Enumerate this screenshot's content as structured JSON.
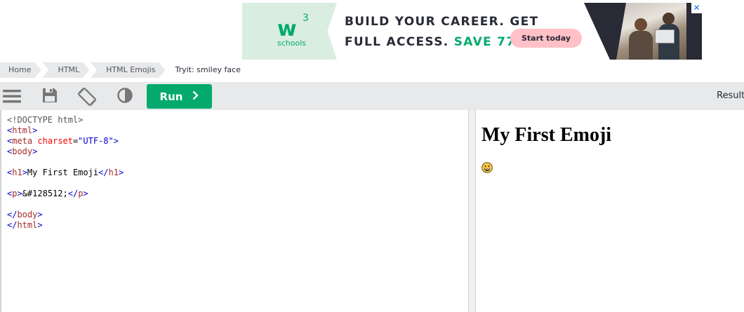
{
  "ad": {
    "logo_letters": "w",
    "logo_sup": "3",
    "logo_sub": "schools",
    "line1": "BUILD YOUR CAREER. GET",
    "line2_prefix": "FULL ACCESS. ",
    "line2_accent": "SAVE 770$",
    "cta_label": "Start today",
    "close_icon": "close-icon",
    "colors": {
      "brand": "#04aa6d",
      "cta": "#ffc0c7",
      "dark": "#282a35",
      "logo_bg": "#d9eee1"
    }
  },
  "breadcrumb": {
    "items": [
      {
        "label": "Home"
      },
      {
        "label": "HTML"
      },
      {
        "label": "HTML Emojis"
      },
      {
        "label": "Tryit: smiley face"
      }
    ]
  },
  "toolbar": {
    "icons": [
      "menu-icon",
      "save-icon",
      "rotate-icon",
      "contrast-icon",
      "chevron-right-icon"
    ],
    "run_label": "Run",
    "result_label": "Result",
    "run_color": "#04aa6d"
  },
  "code": {
    "lines": [
      {
        "doctype": "<!DOCTYPE html>"
      },
      {
        "open": "<",
        "tag": "html",
        "close": ">"
      },
      {
        "open": "<",
        "tag": "meta",
        "attr": " charset",
        "eq": "=",
        "val": "\"UTF-8\"",
        "close": ">"
      },
      {
        "open": "<",
        "tag": "body",
        "close": ">"
      },
      {},
      {
        "open": "<",
        "tag": "h1",
        "close": ">",
        "text": "My First Emoji",
        "open2": "</",
        "tag2": "h1",
        "close2": ">"
      },
      {},
      {
        "open": "<",
        "tag": "p",
        "close": ">",
        "text": "&#128512;",
        "open2": "</",
        "tag2": "p",
        "close2": ">"
      },
      {},
      {
        "open": "</",
        "tag": "body",
        "close": ">"
      },
      {
        "open": "</",
        "tag": "html",
        "close": ">"
      }
    ]
  },
  "result": {
    "heading": "My First Emoji",
    "emoji_icon": "grinning-face-icon"
  }
}
